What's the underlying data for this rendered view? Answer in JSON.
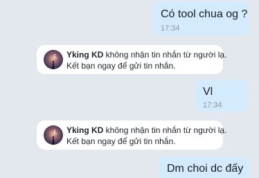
{
  "messages": [
    {
      "text": "Có tool chua og ?",
      "time": "17:34"
    },
    {
      "text": "Vl",
      "time": "17:34"
    },
    {
      "text": "Dm choi dc đấy"
    }
  ],
  "notices": [
    {
      "name": "Yking KD",
      "line1_rest": " không nhận tin nhắn từ người lạ.",
      "line2": "Kết bạn ngay để gửi tin nhắn."
    },
    {
      "name": "Yking KD",
      "line1_rest": " không nhận tin nhắn từ người lạ.",
      "line2": "Kết bạn ngay để gửi tin nhắn."
    }
  ],
  "colors": {
    "background": "#e3e8ee",
    "outgoing_bubble": "#d4ebfd",
    "time_text": "#8b96a1"
  }
}
